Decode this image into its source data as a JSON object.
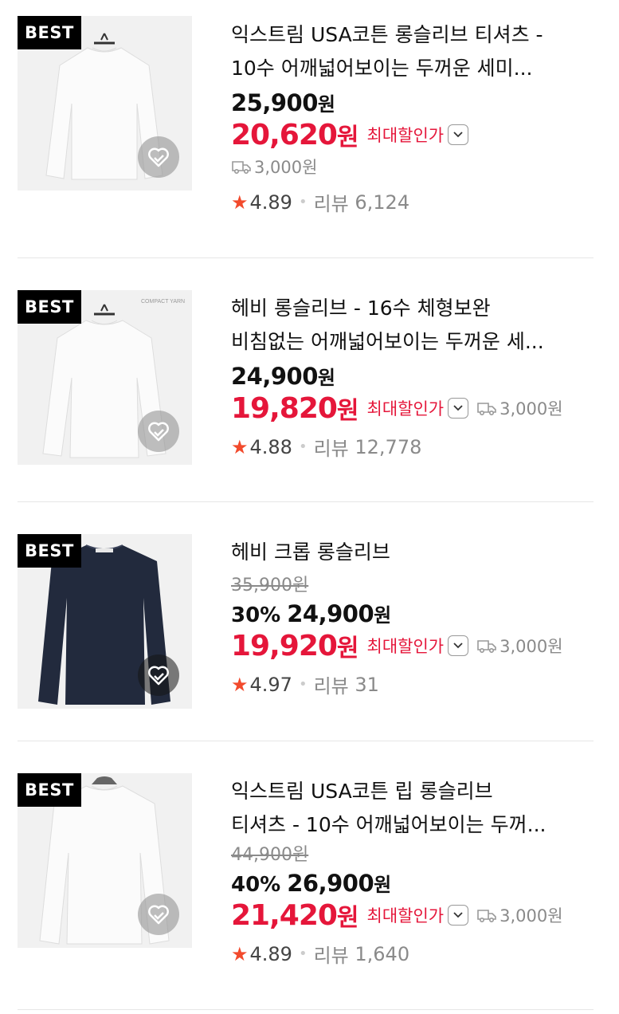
{
  "badge_label": "BEST",
  "max_discount_label": "최대할인가",
  "review_label": "리뷰",
  "colors": {
    "sale": "#e5163a",
    "star": "#f24a2c",
    "muted": "#8a8a8a"
  },
  "products": [
    {
      "title_line1": "익스트림 USA코튼 롱슬리브 티셔츠 -",
      "title_line2": "10수 어깨넓어보이는 두꺼운 세미...",
      "original_price": "",
      "discount_percent": "",
      "price": "25,900",
      "sale_price": "20,620",
      "shipping": "3,000원",
      "rating": "4.89",
      "review_count": "6,124",
      "shirt_color": "#ffffff",
      "thumb_bg": "#f1f1f1"
    },
    {
      "title_line1": "헤비 롱슬리브 - 16수 체형보완",
      "title_line2": "비침없는 어깨넓어보이는 두꺼운 세...",
      "original_price": "",
      "discount_percent": "",
      "price": "24,900",
      "sale_price": "19,820",
      "shipping": "3,000원",
      "rating": "4.88",
      "review_count": "12,778",
      "thumb_caption": "COMPACT YARN",
      "shirt_color": "#ffffff",
      "thumb_bg": "#f1f1f1"
    },
    {
      "title_line1": "헤비 크롭 롱슬리브",
      "title_line2": "",
      "original_price": "35,900원",
      "discount_percent": "30%",
      "price": "24,900",
      "sale_price": "19,920",
      "shipping": "3,000원",
      "rating": "4.97",
      "review_count": "31",
      "shirt_color": "#222a3d",
      "thumb_bg": "#f1f1f1"
    },
    {
      "title_line1": "익스트림 USA코튼 립 롱슬리브",
      "title_line2": "티셔츠 - 10수 어깨넓어보이는 두꺼...",
      "original_price": "44,900원",
      "discount_percent": "40%",
      "price": "26,900",
      "sale_price": "21,420",
      "shipping": "3,000원",
      "rating": "4.89",
      "review_count": "1,640",
      "shirt_color": "#ffffff",
      "thumb_bg": "#f1f1f1"
    }
  ]
}
